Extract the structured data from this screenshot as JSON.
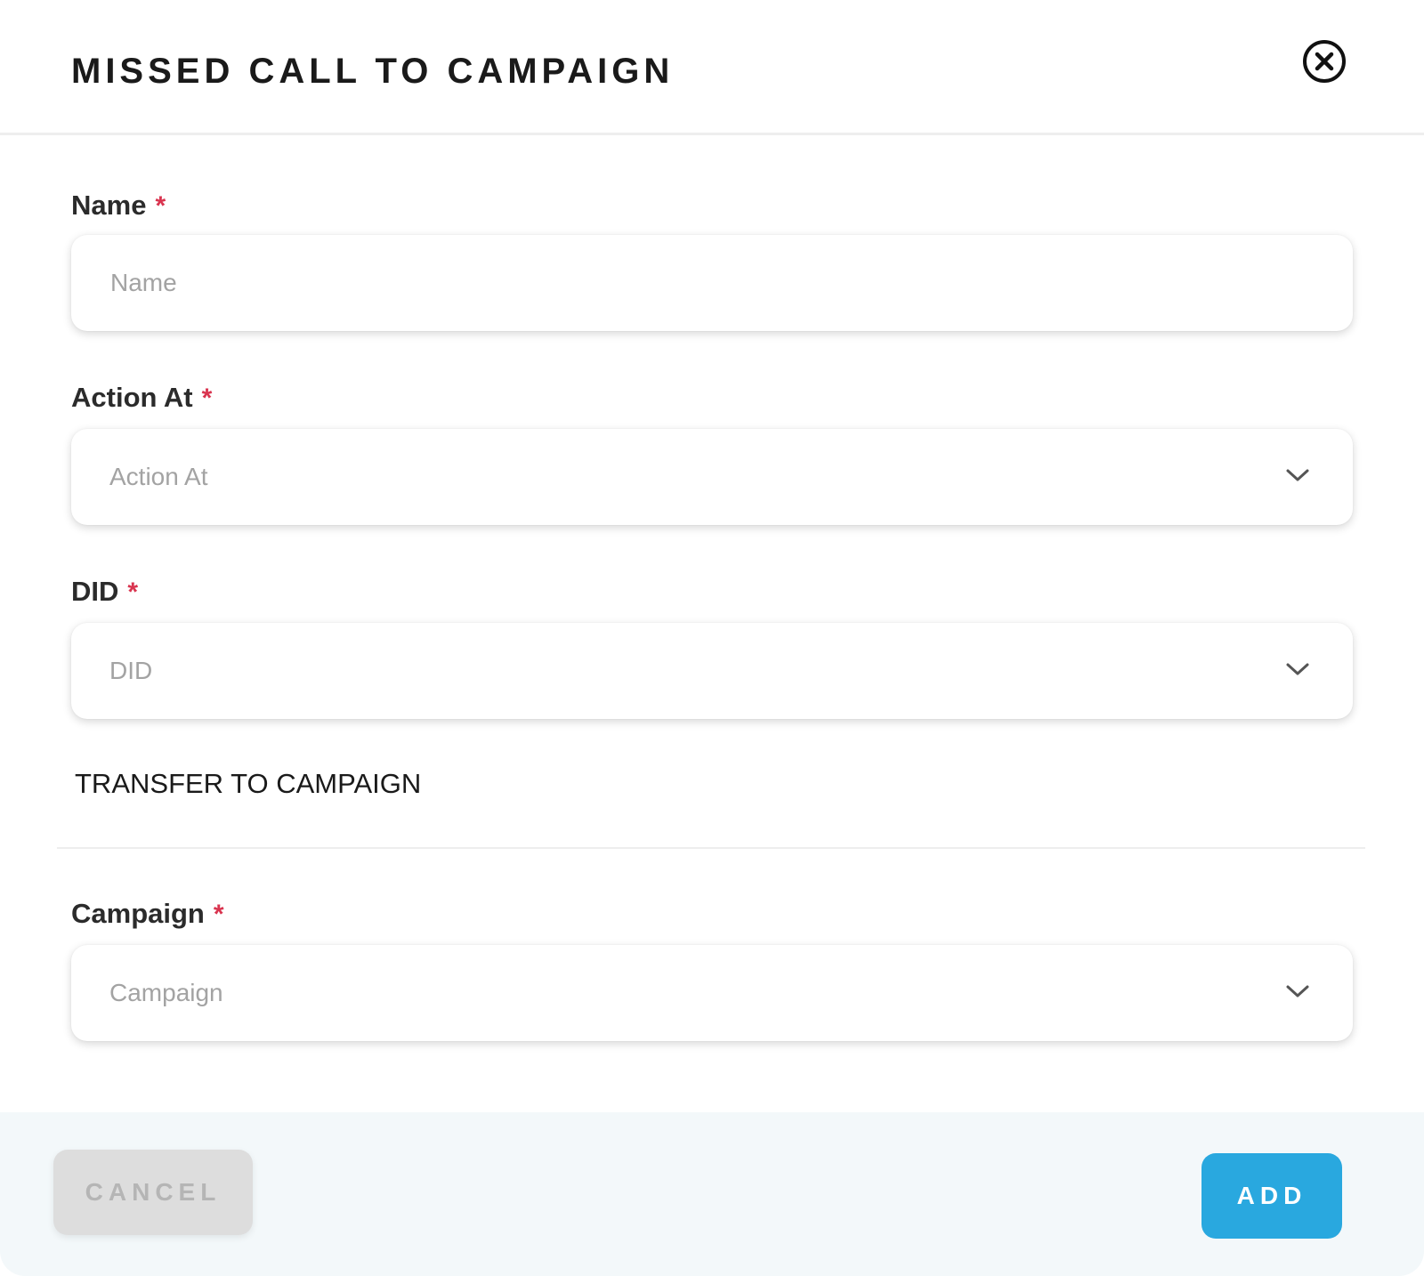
{
  "modal": {
    "title": "MISSED CALL TO CAMPAIGN",
    "close_icon": "close-circle-icon"
  },
  "fields": {
    "name": {
      "label": "Name",
      "required_marker": "*",
      "placeholder": "Name",
      "value": ""
    },
    "action_at": {
      "label": "Action At",
      "required_marker": "*",
      "placeholder": "Action At",
      "icon": "chevron-down-icon"
    },
    "did": {
      "label": "DID",
      "required_marker": "*",
      "placeholder": "DID",
      "icon": "chevron-down-icon"
    }
  },
  "transfer_section": {
    "title": "TRANSFER TO CAMPAIGN",
    "campaign": {
      "label": "Campaign",
      "required_marker": "*",
      "placeholder": "Campaign",
      "icon": "chevron-down-icon"
    }
  },
  "footer": {
    "cancel_label": "CANCEL",
    "add_label": "ADD"
  },
  "colors": {
    "accent": "#29a8df",
    "required": "#d9344f",
    "placeholder": "#a3a3a3",
    "footer_background": "#f3f8fa",
    "cancel_background": "#dddddd",
    "cancel_text": "#b5b5b5"
  }
}
